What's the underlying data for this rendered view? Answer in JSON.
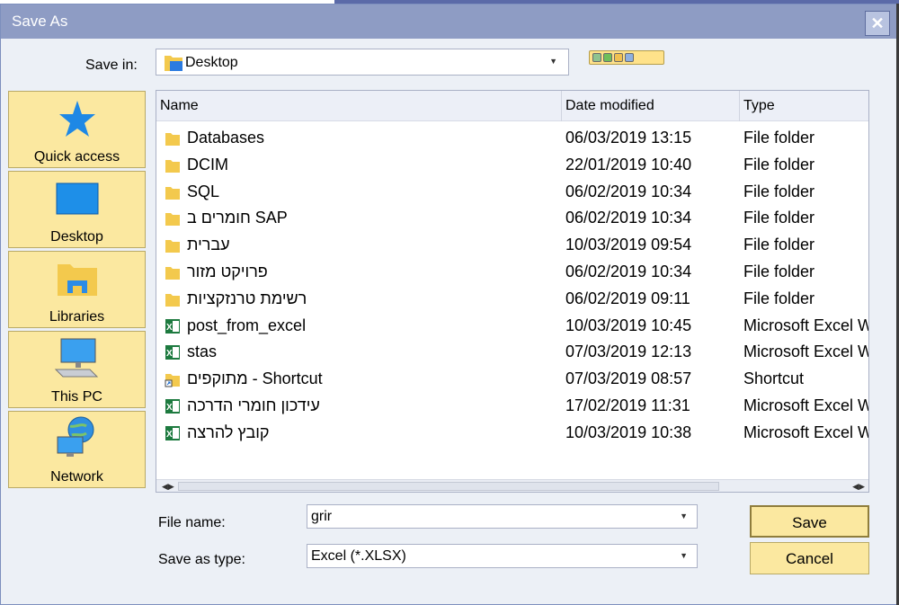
{
  "window": {
    "title": "Save As",
    "close_glyph": "✕"
  },
  "save_in": {
    "label": "Save in:",
    "value": "Desktop",
    "icon": "folder-icon"
  },
  "places": [
    {
      "label": "Quick access",
      "icon": "star-icon"
    },
    {
      "label": "Desktop",
      "icon": "desktop-icon"
    },
    {
      "label": "Libraries",
      "icon": "libraries-icon"
    },
    {
      "label": "This PC",
      "icon": "computer-icon"
    },
    {
      "label": "Network",
      "icon": "network-icon"
    }
  ],
  "columns": {
    "name": "Name",
    "date": "Date modified",
    "type": "Type"
  },
  "files": [
    {
      "name": "Databases",
      "date": "06/03/2019 13:15",
      "type": "File folder",
      "icon": "folder-icon"
    },
    {
      "name": "DCIM",
      "date": "22/01/2019 10:40",
      "type": "File folder",
      "icon": "folder-icon"
    },
    {
      "name": "SQL",
      "date": "06/02/2019 10:34",
      "type": "File folder",
      "icon": "folder-icon"
    },
    {
      "name": "חומרים ב SAP",
      "date": "06/02/2019 10:34",
      "type": "File folder",
      "icon": "folder-icon"
    },
    {
      "name": "עברית",
      "date": "10/03/2019 09:54",
      "type": "File folder",
      "icon": "folder-icon"
    },
    {
      "name": "פרויקט מזור",
      "date": "06/02/2019 10:34",
      "type": "File folder",
      "icon": "folder-icon"
    },
    {
      "name": "רשימת טרנזקציות",
      "date": "06/02/2019 09:11",
      "type": "File folder",
      "icon": "folder-icon"
    },
    {
      "name": "post_from_excel",
      "date": "10/03/2019 10:45",
      "type": "Microsoft Excel W",
      "icon": "excel-icon"
    },
    {
      "name": "stas",
      "date": "07/03/2019 12:13",
      "type": "Microsoft Excel W",
      "icon": "excel-icon"
    },
    {
      "name": "מתוקפים - Shortcut",
      "date": "07/03/2019 08:57",
      "type": "Shortcut",
      "icon": "shortcut-icon"
    },
    {
      "name": "עידכון חומרי הדרכה",
      "date": "17/02/2019 11:31",
      "type": "Microsoft Excel W",
      "icon": "excel-icon"
    },
    {
      "name": "קובץ להרצה",
      "date": "10/03/2019 10:38",
      "type": "Microsoft Excel W",
      "icon": "excel-icon"
    }
  ],
  "file_name": {
    "label": "File name:",
    "value": "grir"
  },
  "save_type": {
    "label": "Save as type:",
    "value": "Excel (*.XLSX)"
  },
  "buttons": {
    "save": "Save",
    "cancel": "Cancel"
  },
  "colors": {
    "titlebar": "#8e9cc4",
    "button": "#fbe8a0",
    "dialog_bg": "#ecf0f6"
  }
}
